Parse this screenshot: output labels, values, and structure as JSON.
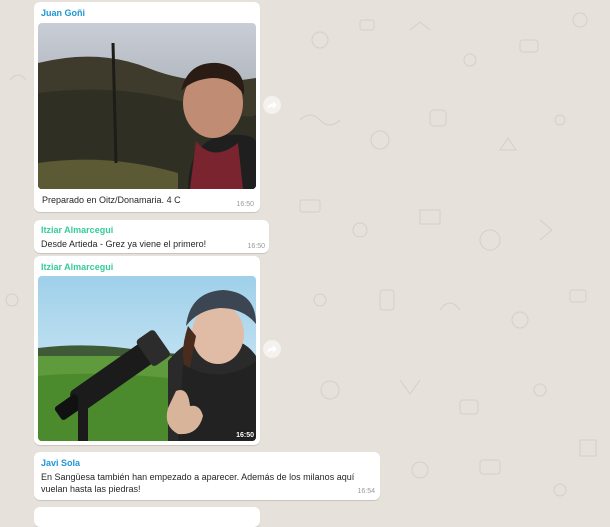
{
  "chat": {
    "messages": [
      {
        "sender": "Juan Goñi",
        "caption": "Preparado en Oitz/Donamaria. 4 C",
        "time": "16:50"
      },
      {
        "sender": "Itziar Almarcegui",
        "text": "Desde Artieda - Grez ya viene el primero!",
        "time": "16:50"
      },
      {
        "sender": "Itziar Almarcegui",
        "time": "16:50"
      },
      {
        "sender": "Javi Sola",
        "text_line1": "En Sangüesa también han empezado a aparecer. Además de los milanos aquí",
        "text_line2": "vuelan hasta las piedras!",
        "time": "16:54"
      }
    ]
  },
  "icons": {
    "forward": "forward-arrow-icon"
  },
  "colors": {
    "background": "#e6e1da",
    "bubble": "#ffffff",
    "sender_green": "#35cd96"
  }
}
